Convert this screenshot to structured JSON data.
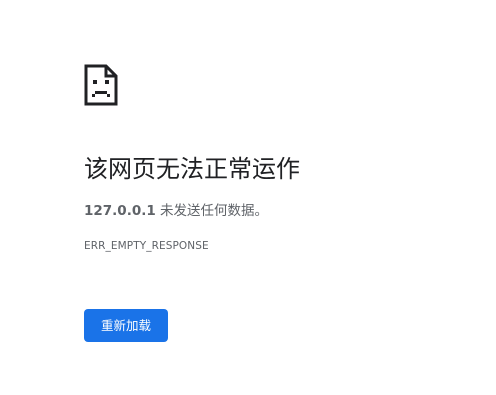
{
  "error_page": {
    "headline": "该网页无法正常运作",
    "host": "127.0.0.1",
    "message": " 未发送任何数据。",
    "error_code": "ERR_EMPTY_RESPONSE",
    "reload_label": "重新加载",
    "icon": "sad-page-icon"
  },
  "colors": {
    "accent": "#1a73e8",
    "text_primary": "#202124",
    "text_secondary": "#5f6368"
  }
}
